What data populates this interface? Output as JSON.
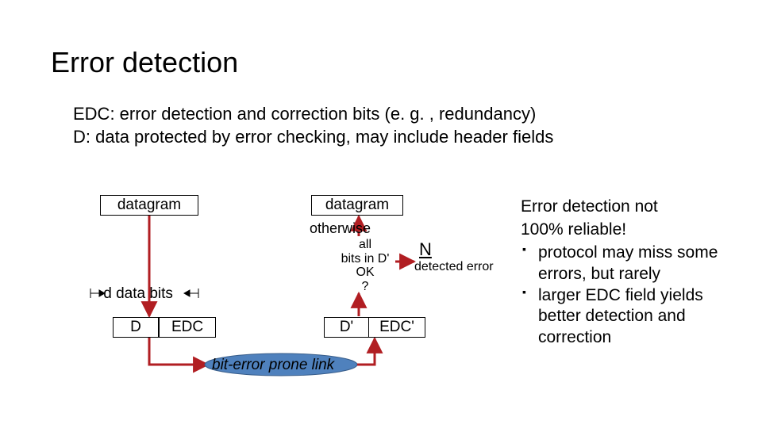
{
  "title": "Error detection",
  "defs": {
    "line1": "EDC: error detection and correction bits (e. g. , redundancy)",
    "line2": "D:  data protected by error checking, may include header fields"
  },
  "diagram": {
    "datagram_left": "datagram",
    "datagram_right": "datagram",
    "otherwise": "otherwise",
    "decision": "all\nbits in D'\nOK\n?",
    "N": "N",
    "detected": "detected error",
    "d_bits": "d data bits",
    "D": "D",
    "EDC": "EDC",
    "Dp": "D'",
    "EDCp": "EDC'",
    "link": "bit-error prone link"
  },
  "bullets": {
    "head1": "Error detection not",
    "head2": "100% reliable!",
    "item1": "protocol may miss some errors, but rarely",
    "item2": "larger EDC field yields better detection and correction"
  },
  "colors": {
    "flow": "#b11e22",
    "link_fill": "#4f81bd",
    "link_stroke": "#385d8a"
  }
}
